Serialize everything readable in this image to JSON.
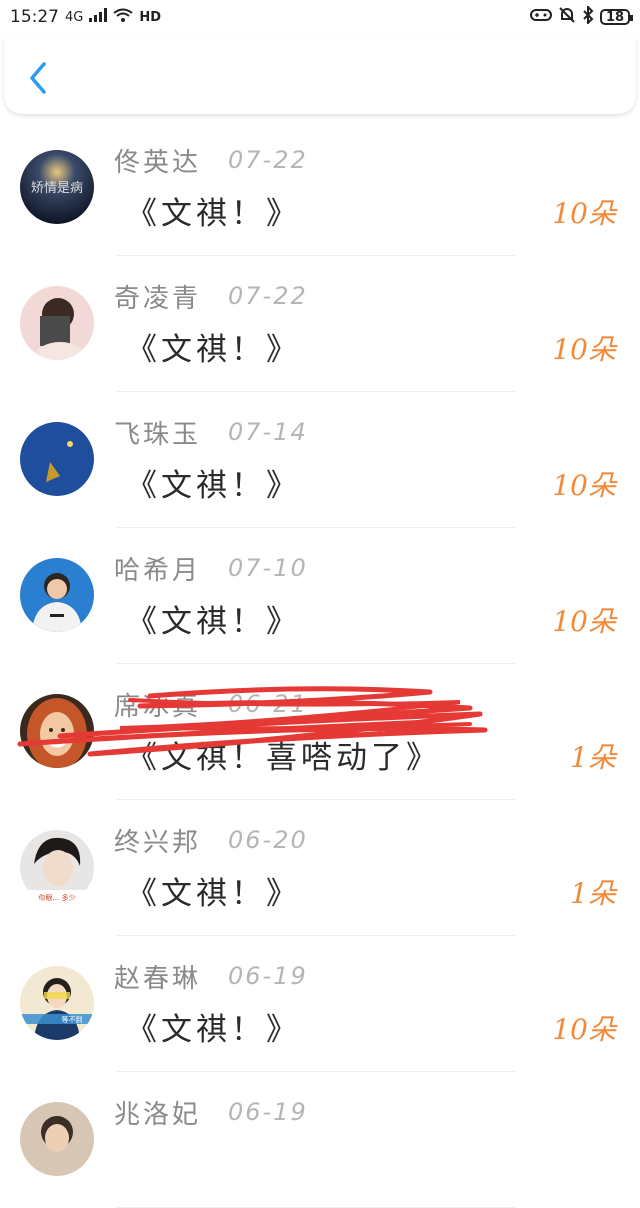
{
  "status": {
    "time": "15:27",
    "network": "4G",
    "hd": "HD",
    "battery": "18"
  },
  "colors": {
    "accent": "#2b9bf4",
    "amount": "#f28a3c",
    "scribble": "#e53935"
  },
  "header": {
    "back_icon": "chevron-left-icon"
  },
  "records": [
    {
      "name": "佟英达",
      "date": "07-22",
      "message": "《文祺！》",
      "amount": "10朵"
    },
    {
      "name": "奇凌青",
      "date": "07-22",
      "message": "《文祺！》",
      "amount": "10朵"
    },
    {
      "name": "飞珠玉",
      "date": "07-14",
      "message": "《文祺！》",
      "amount": "10朵"
    },
    {
      "name": "哈希月",
      "date": "07-10",
      "message": "《文祺！》",
      "amount": "10朵"
    },
    {
      "name": "席冰真",
      "date": "06-21",
      "message": "《文祺！喜嗒动了》",
      "amount": "1朵"
    },
    {
      "name": "终兴邦",
      "date": "06-20",
      "message": "《文祺！》",
      "amount": "1朵"
    },
    {
      "name": "赵春琳",
      "date": "06-19",
      "message": "《文祺！》",
      "amount": "10朵"
    },
    {
      "name": "兆洛妃",
      "date": "06-19",
      "message": "",
      "amount": ""
    }
  ]
}
